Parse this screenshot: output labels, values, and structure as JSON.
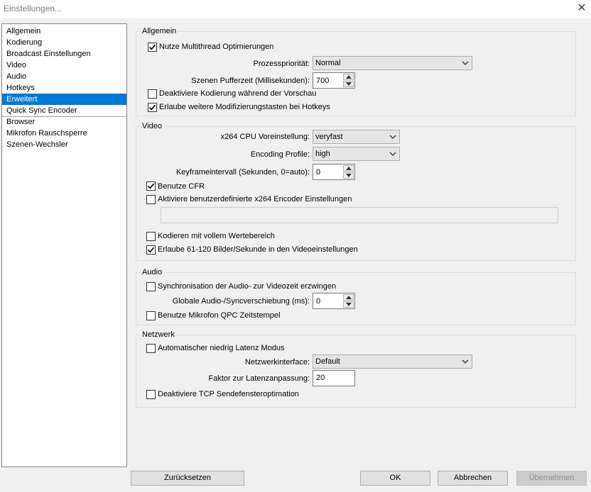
{
  "window": {
    "title": "Einstellungen..."
  },
  "sidebar": {
    "items": [
      {
        "label": "Allgemein"
      },
      {
        "label": "Kodierung"
      },
      {
        "label": "Broadcast Einstellungen"
      },
      {
        "label": "Video"
      },
      {
        "label": "Audio"
      },
      {
        "label": "Hotkeys"
      },
      {
        "label": "Erweitert",
        "selected": true
      },
      {
        "label": "Quick Sync Encoder"
      },
      {
        "label": "Browser"
      },
      {
        "label": "Mikrofon Rauschsperre"
      },
      {
        "label": "Szenen-Wechsler"
      }
    ]
  },
  "general": {
    "group_label": "Allgemein",
    "multithread": {
      "label": "Nutze Multithread Optimierungen",
      "checked": true
    },
    "priority": {
      "label": "Prozesspriorität:",
      "value": "Normal"
    },
    "buffer": {
      "label": "Szenen Pufferzeit (Millisekunden):",
      "value": "700"
    },
    "disable_preview_enc": {
      "label": "Deaktiviere Kodierung während der Vorschau",
      "checked": false
    },
    "hotkey_mods": {
      "label": "Erlaube weitere Modifizierungstasten bei Hotkeys",
      "checked": true
    }
  },
  "video": {
    "group_label": "Video",
    "preset": {
      "label": "x264 CPU Voreinstellung:",
      "value": "veryfast"
    },
    "profile": {
      "label": "Encoding Profile:",
      "value": "high"
    },
    "keyframe": {
      "label": "Keyframeintervall (Sekunden, 0=auto):",
      "value": "0"
    },
    "cfr": {
      "label": "Benutze CFR",
      "checked": true
    },
    "custom_x264": {
      "label": "Aktiviere benutzerdefinierte x264 Encoder Einstellungen",
      "checked": false
    },
    "custom_x264_value": "",
    "full_range": {
      "label": "Kodieren mit vollem Wertebereich",
      "checked": false
    },
    "high_fps": {
      "label": "Erlaube 61-120 Bilder/Sekunde in den Videoeinstellungen",
      "checked": true
    }
  },
  "audio": {
    "group_label": "Audio",
    "sync": {
      "label": "Synchronisation der Audio- zur Videozeit erzwingen",
      "checked": false
    },
    "offset": {
      "label": "Globale Audio-/Syncverschiebung (ms):",
      "value": "0"
    },
    "qpc": {
      "label": "Benutze Mikrofon QPC Zeitstempel",
      "checked": false
    }
  },
  "network": {
    "group_label": "Netzwerk",
    "low_latency": {
      "label": "Automatischer niedrig Latenz Modus",
      "checked": false
    },
    "interface": {
      "label": "Netzwerkinterface:",
      "value": "Default"
    },
    "latency_factor": {
      "label": "Faktor zur Latenzanpassung:",
      "value": "20"
    },
    "tcp_opt": {
      "label": "Deaktiviere TCP Sendefensteroptimation",
      "checked": false
    }
  },
  "buttons": {
    "reset": "Zurücksetzen",
    "ok": "OK",
    "cancel": "Abbrechen",
    "apply": "Übernehmen"
  },
  "colors": {
    "selection": "#0078d7",
    "disabled_text": "#8c8c8c"
  }
}
